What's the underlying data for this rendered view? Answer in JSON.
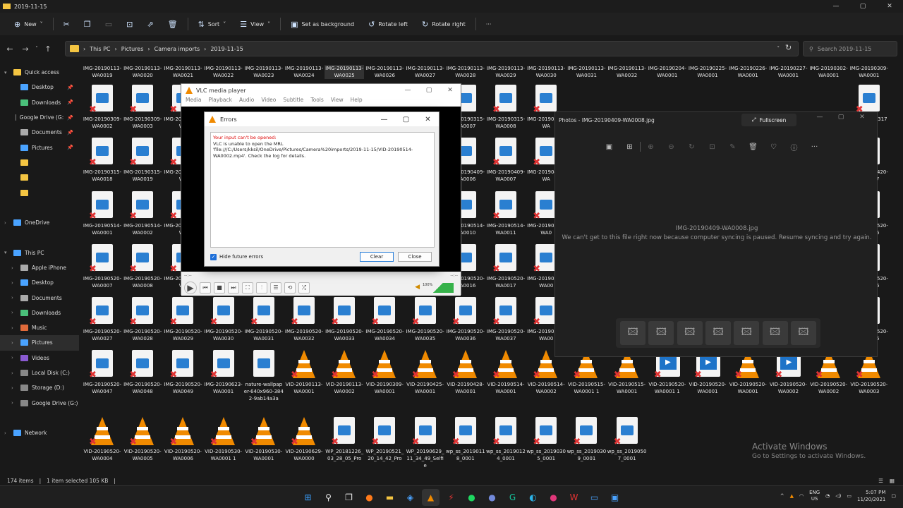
{
  "window": {
    "title": "2019-11-15",
    "minimize": "—",
    "maximize": "▢",
    "close": "✕"
  },
  "toolbar": {
    "new": "New",
    "sort": "Sort",
    "view": "View",
    "set_background": "Set as background",
    "rotate_left": "Rotate left",
    "rotate_right": "Rotate right",
    "more": "···"
  },
  "address": {
    "crumbs": [
      "This PC",
      "Pictures",
      "Camera imports",
      "2019-11-15"
    ],
    "search_placeholder": "Search 2019-11-15"
  },
  "sidebar": {
    "items": [
      {
        "label": "Quick access",
        "icon": "star-icon",
        "color": "#f4c542",
        "indent": 0,
        "chev": "▾"
      },
      {
        "label": "Desktop",
        "icon": "desktop-icon",
        "color": "#4aa3ff",
        "indent": 1,
        "pin": true
      },
      {
        "label": "Downloads",
        "icon": "download-icon",
        "color": "#4ac07a",
        "indent": 1,
        "pin": true
      },
      {
        "label": "Google Drive (G:",
        "icon": "drive-icon",
        "color": "#888888",
        "indent": 1,
        "pin": true
      },
      {
        "label": "Documents",
        "icon": "documents-icon",
        "color": "#aaaaaa",
        "indent": 1,
        "pin": true
      },
      {
        "label": "Pictures",
        "icon": "pictures-icon",
        "color": "#4aa3ff",
        "indent": 1,
        "pin": true
      },
      {
        "label": "",
        "icon": "folder-icon",
        "color": "#f4c542",
        "indent": 1
      },
      {
        "label": "",
        "icon": "folder-icon",
        "color": "#f4c542",
        "indent": 1
      },
      {
        "label": "",
        "icon": "folder-icon",
        "color": "#f4c542",
        "indent": 1
      },
      {
        "label": "",
        "icon": "",
        "color": "",
        "indent": 0
      },
      {
        "label": "OneDrive",
        "icon": "cloud-icon",
        "color": "#4aa3ff",
        "indent": 0,
        "chev": "›"
      },
      {
        "label": "",
        "icon": "",
        "color": "",
        "indent": 0
      },
      {
        "label": "This PC",
        "icon": "pc-icon",
        "color": "#4aa3ff",
        "indent": 0,
        "chev": "▾"
      },
      {
        "label": "Apple iPhone",
        "icon": "phone-icon",
        "color": "#aaaaaa",
        "indent": 1,
        "chev": "›"
      },
      {
        "label": "Desktop",
        "icon": "desktop-icon",
        "color": "#4aa3ff",
        "indent": 1,
        "chev": "›"
      },
      {
        "label": "Documents",
        "icon": "documents-icon",
        "color": "#aaaaaa",
        "indent": 1,
        "chev": "›"
      },
      {
        "label": "Downloads",
        "icon": "download-icon",
        "color": "#4ac07a",
        "indent": 1,
        "chev": "›"
      },
      {
        "label": "Music",
        "icon": "music-icon",
        "color": "#e06a3a",
        "indent": 1,
        "chev": "›"
      },
      {
        "label": "Pictures",
        "icon": "pictures-icon",
        "color": "#4aa3ff",
        "indent": 1,
        "chev": "›",
        "selected": true
      },
      {
        "label": "Videos",
        "icon": "videos-icon",
        "color": "#8a5ad1",
        "indent": 1,
        "chev": "›"
      },
      {
        "label": "Local Disk (C:)",
        "icon": "disk-icon",
        "color": "#888888",
        "indent": 1,
        "chev": "›"
      },
      {
        "label": "Storage (D:)",
        "icon": "disk-icon",
        "color": "#888888",
        "indent": 1,
        "chev": "›"
      },
      {
        "label": "Google Drive (G:)",
        "icon": "drive-icon",
        "color": "#888888",
        "indent": 1,
        "chev": "›"
      },
      {
        "label": "",
        "icon": "",
        "color": "",
        "indent": 0
      },
      {
        "label": "Network",
        "icon": "network-icon",
        "color": "#4aa3ff",
        "indent": 0,
        "chev": "›"
      }
    ]
  },
  "files_row0": [
    "IMG-20190113-WA0019",
    "IMG-20190113-WA0020",
    "IMG-20190113-WA0021",
    "IMG-20190113-WA0022",
    "IMG-20190113-WA0023",
    "IMG-20190113-WA0024",
    "IMG-20190113-WA0025",
    "IMG-20190113-WA0026",
    "IMG-20190113-WA0027",
    "IMG-20190113-WA0028",
    "IMG-20190113-WA0029",
    "IMG-20190113-WA0030",
    "IMG-20190113-WA0031",
    "IMG-20190113-WA0032",
    "IMG-20190204-WA0001",
    "IMG-20190225-WA0001",
    "IMG-20190226-WA0001",
    "IMG-20190227-WA0001",
    "IMG-20190302-WA0001",
    "IMG-20190309-WA0001"
  ],
  "grid": [
    [
      {
        "n": "IMG-20190309-WA0002",
        "t": "img"
      },
      {
        "n": "IMG-20190309-WA0003",
        "t": "img"
      },
      {
        "n": "IMG-20190309-WA",
        "t": "img"
      },
      null,
      null,
      null,
      null,
      null,
      null,
      {
        "n": "IMG-20190315-WA0007",
        "t": "img"
      },
      {
        "n": "IMG-20190315-WA0008",
        "t": "img"
      },
      {
        "n": "IMG-20190315-WA",
        "t": "img"
      },
      null,
      null,
      null,
      null,
      null,
      null,
      null,
      {
        "n": "IMG-20190317",
        "t": "img"
      }
    ],
    [
      {
        "n": "IMG-20190315-WA0018",
        "t": "img"
      },
      {
        "n": "IMG-20190315-WA0019",
        "t": "img"
      },
      {
        "n": "IMG-20190315-WA",
        "t": "img"
      },
      null,
      null,
      null,
      null,
      null,
      null,
      {
        "n": "IMG-20190409-WA0006",
        "t": "img"
      },
      {
        "n": "IMG-20190409-WA0007",
        "t": "img"
      },
      {
        "n": "IMG-20190409-WA",
        "t": "img"
      },
      null,
      null,
      null,
      null,
      null,
      null,
      null,
      {
        "n": "IMG-20190420-WA0007",
        "t": "img"
      }
    ],
    [
      {
        "n": "IMG-20190514-WA0001",
        "t": "img"
      },
      {
        "n": "IMG-20190514-WA0002",
        "t": "img"
      },
      {
        "n": "IMG-20190514-WA",
        "t": "img"
      },
      null,
      null,
      null,
      null,
      null,
      null,
      {
        "n": "IMG-20190514-WA0010",
        "t": "img"
      },
      {
        "n": "IMG-20190514-WA0011",
        "t": "img"
      },
      {
        "n": "IMG-20190514-WA0",
        "t": "img"
      },
      null,
      null,
      null,
      null,
      null,
      null,
      null,
      {
        "n": "IMG-20190520-WA0006",
        "t": "img"
      }
    ],
    [
      {
        "n": "IMG-20190520-WA0007",
        "t": "img"
      },
      {
        "n": "IMG-20190520-WA0008",
        "t": "img"
      },
      {
        "n": "IMG-20190520-WA",
        "t": "img"
      },
      null,
      null,
      null,
      null,
      null,
      null,
      {
        "n": "IMG-20190520-WA0016",
        "t": "img"
      },
      {
        "n": "IMG-20190520-WA0017",
        "t": "img"
      },
      {
        "n": "IMG-20190520-WA00",
        "t": "img"
      },
      null,
      null,
      null,
      null,
      null,
      null,
      null,
      {
        "n": "IMG-20190520-WA0026",
        "t": "img"
      }
    ],
    [
      {
        "n": "IMG-20190520-WA0027",
        "t": "img"
      },
      {
        "n": "IMG-20190520-WA0028",
        "t": "img"
      },
      {
        "n": "IMG-20190520-WA0029",
        "t": "img"
      },
      {
        "n": "IMG-20190520-WA0030",
        "t": "img"
      },
      {
        "n": "IMG-20190520-WA0031",
        "t": "img"
      },
      {
        "n": "IMG-20190520-WA0032",
        "t": "img"
      },
      {
        "n": "IMG-20190520-WA0033",
        "t": "img"
      },
      {
        "n": "IMG-20190520-WA0034",
        "t": "img"
      },
      {
        "n": "IMG-20190520-WA0035",
        "t": "img"
      },
      {
        "n": "IMG-20190520-WA0036",
        "t": "img"
      },
      {
        "n": "IMG-20190520-WA0037",
        "t": "img"
      },
      {
        "n": "IMG-20190520-WA00",
        "t": "img"
      },
      null,
      null,
      null,
      null,
      null,
      null,
      null,
      {
        "n": "IMG-20190520-WA0046",
        "t": "img"
      }
    ],
    [
      {
        "n": "IMG-20190520-WA0047",
        "t": "img"
      },
      {
        "n": "IMG-20190520-WA0048",
        "t": "img"
      },
      {
        "n": "IMG-20190520-WA0049",
        "t": "img"
      },
      {
        "n": "IMG-20190623-WA0001",
        "t": "img"
      },
      {
        "n": "nature-wallpaper-640x960-3842-9ab14a3a",
        "t": "img",
        "x": false
      },
      {
        "n": "VID-20190113-WA0001",
        "t": "vlc"
      },
      {
        "n": "VID-20190113-WA0002",
        "t": "vlc"
      },
      {
        "n": "VID-20190309-WA0001",
        "t": "vlc"
      },
      {
        "n": "VID-20190425-WA0001",
        "t": "vlc"
      },
      {
        "n": "VID-20190428-WA0001",
        "t": "vlc"
      },
      {
        "n": "VID-20190514-WA0001",
        "t": "vlc"
      },
      {
        "n": "VID-20190514-WA0002",
        "t": "vlc"
      },
      {
        "n": "VID-20190515-WA0001 1",
        "t": "vlc"
      },
      {
        "n": "VID-20190515-WA0001",
        "t": "vlc"
      },
      {
        "n": "VID-20190520-WA0001 1",
        "t": "vid"
      },
      {
        "n": "VID-20190520-WA0001",
        "t": "vid"
      },
      {
        "n": "VID-20190520-WA0001",
        "t": "vlc"
      },
      {
        "n": "VID-20190520-WA0002",
        "t": "vid"
      },
      {
        "n": "VID-20190520-WA0002",
        "t": "vlc"
      },
      {
        "n": "VID-20190520-WA0003",
        "t": "vlc"
      }
    ],
    [
      {
        "n": "VID-20190520-WA0004",
        "t": "vlc"
      },
      {
        "n": "VID-20190520-WA0005",
        "t": "vlc"
      },
      {
        "n": "VID-20190520-WA0006",
        "t": "vlc"
      },
      {
        "n": "VID-20190530-WA0001 1",
        "t": "vlc"
      },
      {
        "n": "VID-20190530-WA0001",
        "t": "vlc"
      },
      {
        "n": "VID-20190629-WA0000",
        "t": "vlc"
      },
      {
        "n": "WP_20181226_03_28_05_Pro",
        "t": "img"
      },
      {
        "n": "WP_20190521_20_14_42_Pro",
        "t": "img"
      },
      {
        "n": "WP_20190629_11_34_49_Selfie",
        "t": "img"
      },
      {
        "n": "wp_ss_20190118_0001",
        "t": "img"
      },
      {
        "n": "wp_ss_20190124_0001",
        "t": "img"
      },
      {
        "n": "wp_ss_20190305_0001",
        "t": "img"
      },
      {
        "n": "wp_ss_20190309_0001",
        "t": "img"
      },
      {
        "n": "wp_ss_20190507_0001",
        "t": "img"
      }
    ]
  ],
  "status": {
    "count": "174 items",
    "selection": "1 item selected  105 KB"
  },
  "vlc": {
    "title": "VLC media player",
    "menu": [
      "Media",
      "Playback",
      "Audio",
      "Video",
      "Subtitle",
      "Tools",
      "View",
      "Help"
    ],
    "time_left": "--:--",
    "time_right": "--:--",
    "volume": "100%"
  },
  "errors": {
    "title": "Errors",
    "heading": "Your input can't be opened:",
    "message": "VLC is unable to open the MRL 'file:///C:/Users/kksil/OneDrive/Pictures/Camera%20imports/2019-11-15/VID-20190514-WA0002.mp4'. Check the log for details.",
    "hide_label": "Hide future errors",
    "clear": "Clear",
    "close": "Close"
  },
  "photos": {
    "title": "Photos - IMG-20190409-WA0008.jpg",
    "fullscreen": "Fullscreen",
    "filename": "IMG-20190409-WA0008.jpg",
    "message": "We can't get to this file right now because computer syncing is paused.  Resume syncing and try again."
  },
  "activate": {
    "title": "Activate Windows",
    "sub": "Go to Settings to activate Windows."
  },
  "taskbar": {
    "lang1": "ENG",
    "lang2": "US",
    "time": "5:07 PM",
    "date": "11/20/2021"
  }
}
